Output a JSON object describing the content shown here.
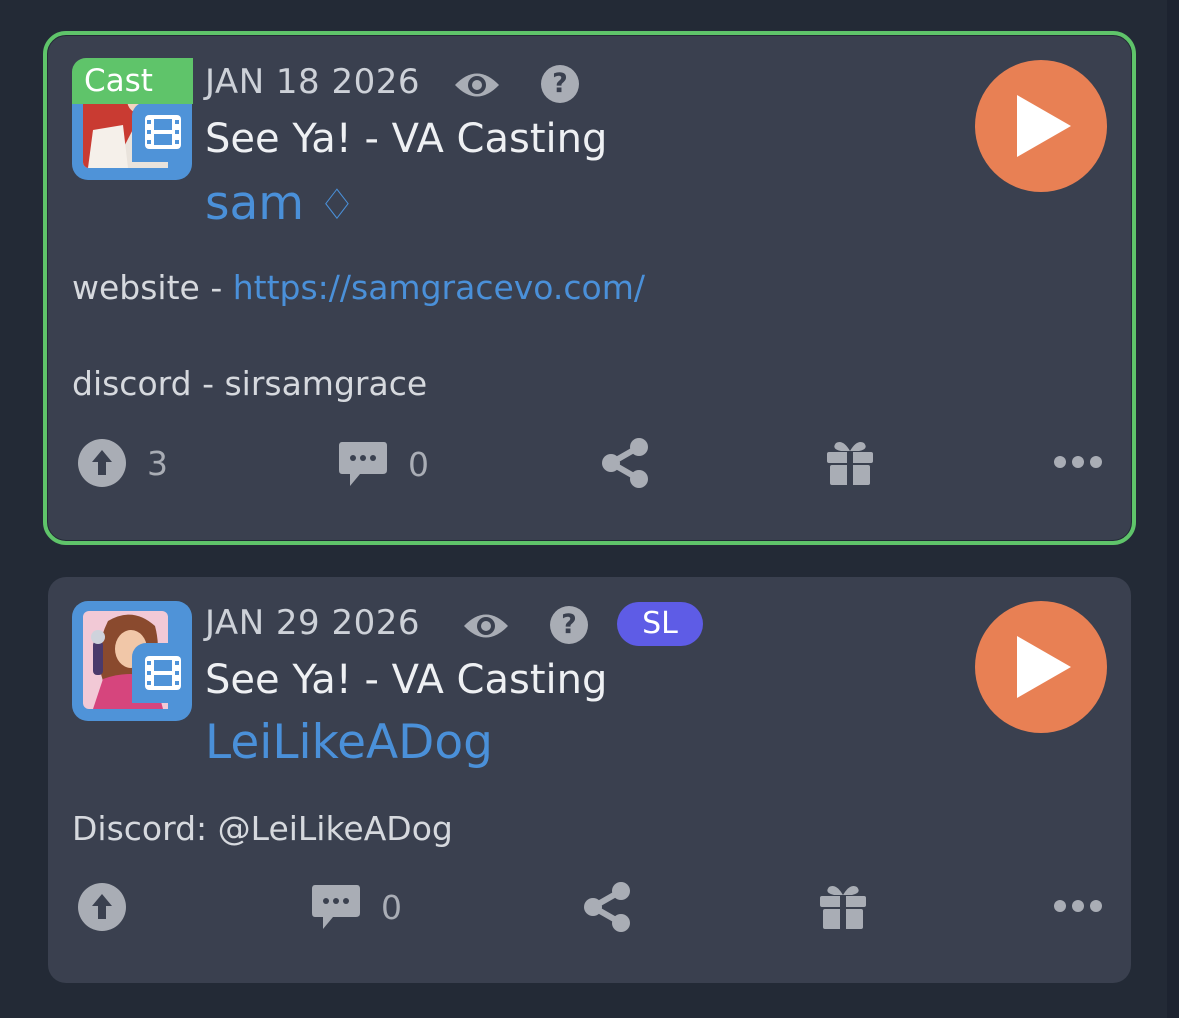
{
  "posts": [
    {
      "badge": "Cast",
      "date": "JAN 18 2026",
      "title": "See Ya! - VA Casting",
      "author": "sam",
      "author_suffix": "♢",
      "body": {
        "website_label": "website - ",
        "website_url": "https://samgracevo.com/",
        "discord": "discord - sirsamgrace"
      },
      "upvotes": "3",
      "comments": "0",
      "highlight_color": "#5fc46a"
    },
    {
      "tag": "SL",
      "date": "JAN 29 2026",
      "title": "See Ya! - VA Casting",
      "author": "LeiLikeADog",
      "body": {
        "discord": "Discord: @LeiLikeADog"
      },
      "comments": "0",
      "tag_color": "#5e5ce6"
    }
  ],
  "colors": {
    "accent": "#4a90d9",
    "play": "#e88054",
    "background": "#232a36",
    "card": "#3a404f"
  },
  "icons": [
    "eye-icon",
    "help-icon",
    "film-icon",
    "play-icon",
    "upvote-icon",
    "comment-icon",
    "share-icon",
    "gift-icon",
    "more-icon"
  ]
}
